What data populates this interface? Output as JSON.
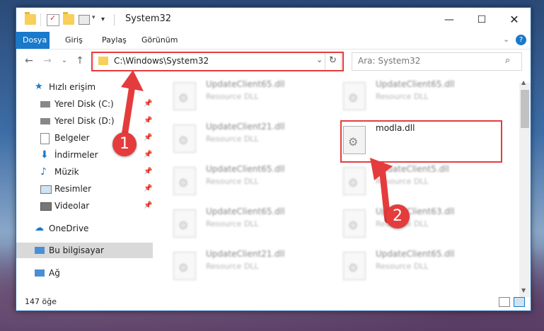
{
  "window": {
    "title": "System32"
  },
  "ribbon": {
    "tabs": [
      "Dosya",
      "Giriş",
      "Paylaş",
      "Görünüm"
    ]
  },
  "address": {
    "path": "C:\\Windows\\System32",
    "search_placeholder": "Ara: System32"
  },
  "sidebar": {
    "items": [
      {
        "label": "Hızlı erişim"
      },
      {
        "label": "Yerel Disk (C:)"
      },
      {
        "label": "Yerel Disk (D:)"
      },
      {
        "label": "Belgeler"
      },
      {
        "label": "İndirmeler"
      },
      {
        "label": "Müzik"
      },
      {
        "label": "Resimler"
      },
      {
        "label": "Videolar"
      },
      {
        "label": "OneDrive"
      },
      {
        "label": "Bu bilgisayar"
      },
      {
        "label": "Ağ"
      }
    ]
  },
  "files": [
    {
      "name": "UpdateClient65.dll",
      "type": "Resource DLL"
    },
    {
      "name": "UpdateClient65.dll",
      "type": "Resource DLL"
    },
    {
      "name": "UpdateClient21.dll",
      "type": "Resource DLL"
    },
    {
      "name": "modla.dll",
      "type": ""
    },
    {
      "name": "UpdateClient65.dll",
      "type": "Resource DLL"
    },
    {
      "name": "UpdateClient5.dll",
      "type": "Resource DLL"
    },
    {
      "name": "UpdateClient65.dll",
      "type": "Resource DLL"
    },
    {
      "name": "UpdateClient63.dll",
      "type": "Resource DLL"
    },
    {
      "name": "UpdateClient21.dll",
      "type": "Resource DLL"
    },
    {
      "name": "UpdateClient65.dll",
      "type": "Resource DLL"
    }
  ],
  "status": {
    "count": "147 öğe"
  },
  "annotations": {
    "badge1": "1",
    "badge2": "2"
  },
  "colors": {
    "accent": "#1979ca",
    "highlight": "#e43c3c"
  }
}
